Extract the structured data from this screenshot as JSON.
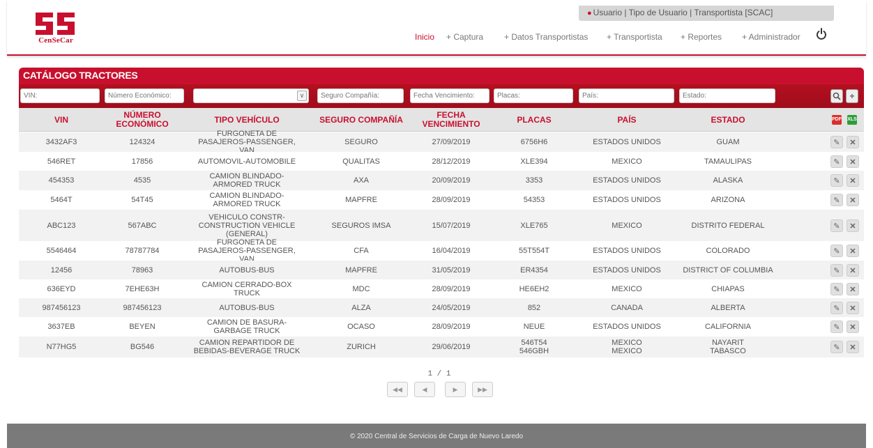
{
  "brand": {
    "logo_text": "CenSeCar",
    "primary_color": "#c8102e"
  },
  "user_bar": {
    "text": "Usuario | Tipo de Usuario  | Transportista [SCAC]",
    "icon": "user-icon"
  },
  "nav": {
    "items": [
      {
        "label": "Inicio"
      },
      {
        "label": "+ Captura"
      },
      {
        "label": "+ Datos Transportistas"
      },
      {
        "label": "+ Transportista"
      },
      {
        "label": "+ Reportes"
      },
      {
        "label": "+ Administrador"
      }
    ],
    "logout_icon": "power-icon"
  },
  "catalog": {
    "title": "CATÁLOGO TRACTORES",
    "filters": {
      "vin": "VIN:",
      "numero_economico": "Número Económico:",
      "tipo_vehiculo": "",
      "seguro": "Seguro Compañía:",
      "fecha": "Fecha Vencimiento:",
      "placas": "Placas:",
      "pais": "País:",
      "estado": "Estado:"
    },
    "headers": [
      "VIN",
      "NÚMERO ECONÓMICO",
      "TIPO VEHÍCULO",
      "SEGURO COMPAÑÍA",
      "FECHA VENCIMIENTO",
      "PLACAS",
      "PAÍS",
      "ESTADO"
    ],
    "rows": [
      [
        "3432AF3",
        "124324",
        "FURGONETA DE PASAJEROS-PASSENGER, VAN",
        "SEGURO",
        "27/09/2019",
        "6756H6",
        "ESTADOS UNIDOS",
        "GUAM"
      ],
      [
        "546RET",
        "17856",
        "AUTOMOVIL-AUTOMOBILE",
        "QUALITAS",
        "28/12/2019",
        "XLE394",
        "MEXICO",
        "TAMAULIPAS"
      ],
      [
        "454353",
        "4535",
        "CAMION BLINDADO-ARMORED TRUCK",
        "AXA",
        "20/09/2019",
        "3353",
        "ESTADOS UNIDOS",
        "ALASKA"
      ],
      [
        "5464T",
        "54T45",
        "CAMION BLINDADO-ARMORED TRUCK",
        "MAPFRE",
        "28/09/2019",
        "54353",
        "ESTADOS UNIDOS",
        "ARIZONA"
      ],
      [
        "ABC123",
        "567ABC",
        "VEHICULO CONSTR-CONSTRUCTION VEHICLE (GENERAL)",
        "SEGUROS IMSA",
        "15/07/2019",
        "XLE765",
        "MEXICO",
        "DISTRITO FEDERAL"
      ],
      [
        "5546464",
        "78787784",
        "FURGONETA DE PASAJEROS-PASSENGER, VAN",
        "CFA",
        "16/04/2019",
        "55T554T",
        "ESTADOS UNIDOS",
        "COLORADO"
      ],
      [
        "12456",
        "78963",
        "AUTOBUS-BUS",
        "MAPFRE",
        "31/05/2019",
        "ER4354",
        "ESTADOS UNIDOS",
        "DISTRICT OF COLUMBIA"
      ],
      [
        "636EYD",
        "7EHE63H",
        "CAMION CERRADO-BOX TRUCK",
        "MDC",
        "28/09/2019",
        "HE6EH2",
        "MEXICO",
        "CHIAPAS"
      ],
      [
        "987456123",
        "987456123",
        "AUTOBUS-BUS",
        "ALZA",
        "24/05/2019",
        "852",
        "CANADA",
        "ALBERTA"
      ],
      [
        "3637EB",
        "BEYEN",
        "CAMION DE BASURA-GARBAGE TRUCK",
        "OCASO",
        "28/09/2019",
        "NEUE",
        "ESTADOS UNIDOS",
        "CALIFORNIA"
      ],
      [
        "N77HG5",
        "BG546",
        "CAMION REPARTIDOR DE BEBIDAS-BEVERAGE TRUCK",
        "ZURICH",
        "29/06/2019",
        "546T54\n546GBH",
        "MEXICO\nMEXICO",
        "NAYARIT\nTABASCO"
      ]
    ],
    "row_actions": {
      "edit_icon": "edit-icon",
      "delete_icon": "delete-icon"
    }
  },
  "pagination": {
    "text": "1 / 1",
    "current": 1,
    "total": 1
  },
  "footer": {
    "text": "© 2020 Central de Servicios de Carga de Nuevo Laredo"
  }
}
